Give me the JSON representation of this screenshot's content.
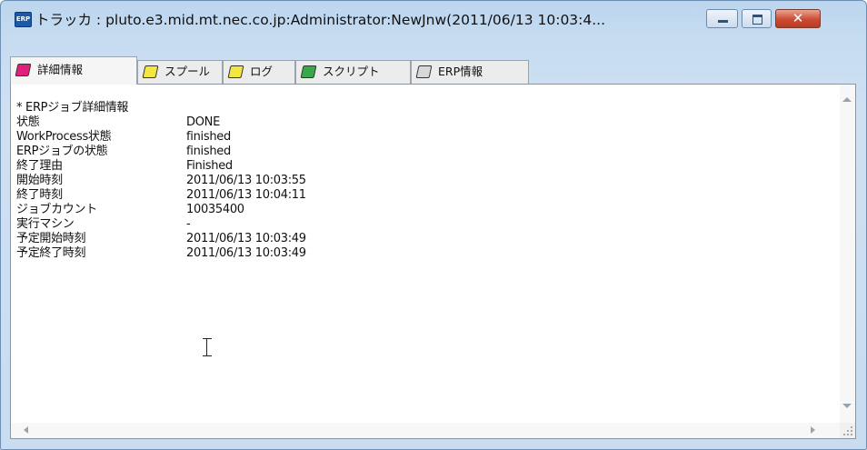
{
  "window": {
    "app_icon_text": "ERP",
    "title": "トラッカ : pluto.e3.mid.mt.nec.co.jp:Administrator:NewJnw(2011/06/13 10:03:4..."
  },
  "tabs": [
    {
      "label": "詳細情報",
      "icon": "notebook-pink-icon",
      "active": true
    },
    {
      "label": "スプール",
      "icon": "notebook-yellow-icon",
      "active": false
    },
    {
      "label": "ログ",
      "icon": "notebook-yellow-icon",
      "active": false
    },
    {
      "label": "スクリプト",
      "icon": "notebook-green-icon",
      "active": false
    },
    {
      "label": "ERP情報",
      "icon": "notebook-gray-icon",
      "active": false
    }
  ],
  "detail": {
    "header": "* ERPジョブ詳細情報",
    "rows": [
      {
        "key": "状態",
        "value": "DONE"
      },
      {
        "key": "WorkProcess状態",
        "value": "finished"
      },
      {
        "key": "ERPジョブの状態",
        "value": "finished"
      },
      {
        "key": "終了理由",
        "value": "Finished"
      },
      {
        "key": "開始時刻",
        "value": "2011/06/13 10:03:55"
      },
      {
        "key": "終了時刻",
        "value": "2011/06/13 10:04:11"
      },
      {
        "key": "ジョブカウント",
        "value": "10035400"
      },
      {
        "key": "実行マシン",
        "value": "-"
      },
      {
        "key": "予定開始時刻",
        "value": "2011/06/13 10:03:49"
      },
      {
        "key": "予定終了時刻",
        "value": "2011/06/13 10:03:49"
      }
    ]
  },
  "colors": {
    "titlebar": "#c6dcf1",
    "close_button": "#cc4b32",
    "active_tab_icon": "#e0207a"
  }
}
